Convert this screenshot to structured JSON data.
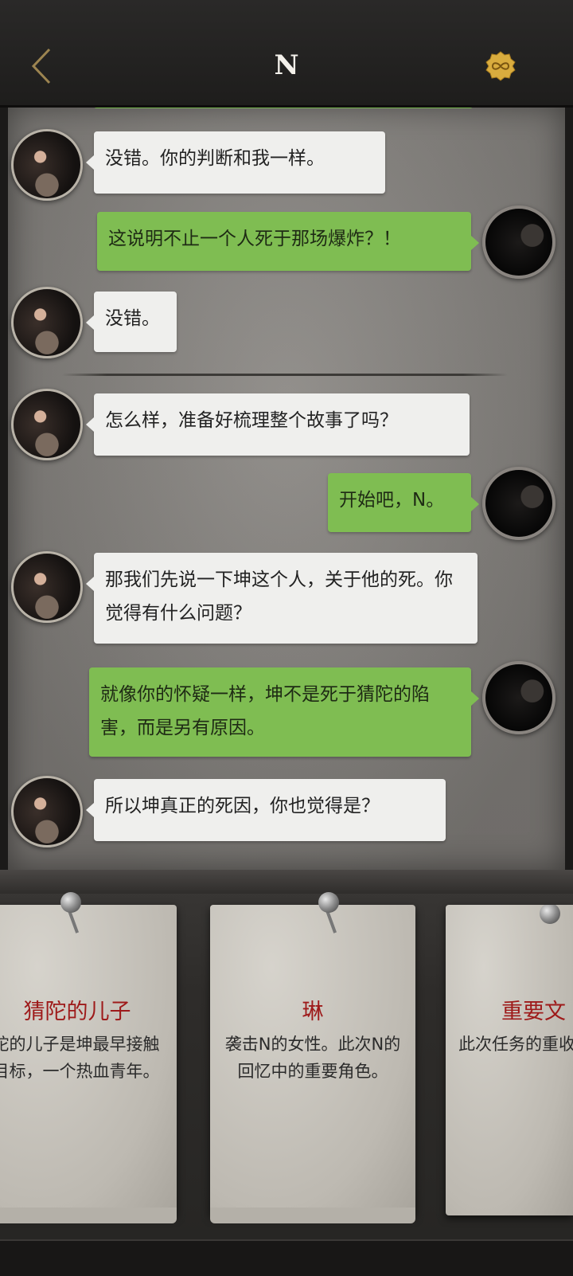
{
  "header": {
    "title": "N",
    "back_icon": "chevron-left-icon",
    "coin_icon": "infinity-coin-icon",
    "accent": "#d4a93c"
  },
  "messages": [
    {
      "side": "left",
      "speaker": "N",
      "text": "没错。你的判断和我一样。"
    },
    {
      "side": "right",
      "speaker": "me",
      "text": "这说明不止一个人死于那场爆炸？！"
    },
    {
      "side": "left",
      "speaker": "N",
      "text": "没错。"
    },
    {
      "side": "left",
      "speaker": "N",
      "text": "怎么样，准备好梳理整个故事了吗？"
    },
    {
      "side": "right",
      "speaker": "me",
      "text": "开始吧，N。"
    },
    {
      "side": "left",
      "speaker": "N",
      "text": "那我们先说一下坤这个人，关于他的死。你觉得有什么问题？"
    },
    {
      "side": "right",
      "speaker": "me",
      "text": "就像你的怀疑一样，坤不是死于猜陀的陷害，而是另有原因。"
    },
    {
      "side": "left",
      "speaker": "N",
      "text": "所以坤真正的死因，你也觉得是？"
    }
  ],
  "cards": [
    {
      "title": "猜陀的儿子",
      "body": "猜陀的儿子是坤最早接触的目标，一个热血青年。"
    },
    {
      "title": "琳",
      "body": "袭击N的女性。此次N的回忆中的重要角色。"
    },
    {
      "title": "重要文",
      "body": "此次任务的重收一份重要"
    }
  ],
  "colors": {
    "left_bubble": "#efefed",
    "right_bubble": "#7fbd52",
    "card_title": "#9e1a1a"
  }
}
